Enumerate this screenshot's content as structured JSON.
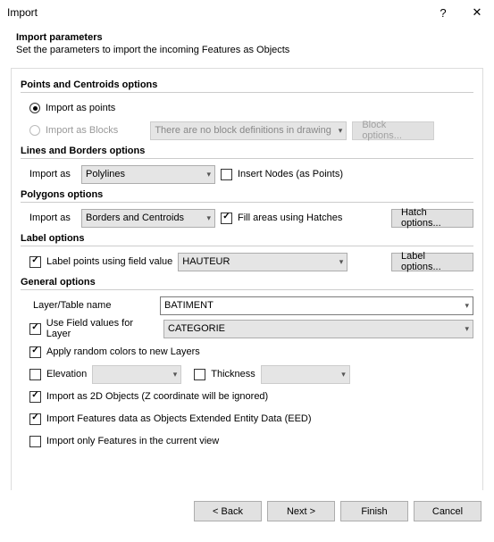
{
  "window": {
    "title": "Import",
    "help": "?",
    "close": "✕"
  },
  "header": {
    "title": "Import parameters",
    "subtitle": "Set the parameters to import the incoming Features as Objects"
  },
  "groups": {
    "points": {
      "title": "Points and Centroids options",
      "radio_points": "Import as points",
      "radio_blocks": "Import as Blocks",
      "blocks_placeholder": "There are no block definitions in drawing",
      "block_options_btn": "Block options..."
    },
    "lines": {
      "title": "Lines and Borders options",
      "import_as_label": "Import as",
      "import_as_value": "Polylines",
      "insert_nodes": "Insert Nodes (as Points)"
    },
    "polygons": {
      "title": "Polygons options",
      "import_as_label": "Import as",
      "import_as_value": "Borders and Centroids",
      "fill_hatches": "Fill areas using Hatches",
      "hatch_options_btn": "Hatch options..."
    },
    "label": {
      "title": "Label options",
      "label_points": "Label points using field value",
      "field_value": "HAUTEUR",
      "label_options_btn": "Label options..."
    },
    "general": {
      "title": "General options",
      "layer_name_label": "Layer/Table name",
      "layer_name_value": "BATIMENT",
      "use_field_values": "Use Field values for Layer",
      "field_values_value": "CATEGORIE",
      "apply_colors": "Apply random colors to new Layers",
      "elevation": "Elevation",
      "thickness": "Thickness",
      "import_2d": "Import as 2D Objects (Z coordinate will be ignored)",
      "import_eed": "Import Features data as Objects Extended Entity Data (EED)",
      "import_view": "Import only Features in the current view"
    }
  },
  "footer": {
    "back": "< Back",
    "next": "Next >",
    "finish": "Finish",
    "cancel": "Cancel"
  }
}
